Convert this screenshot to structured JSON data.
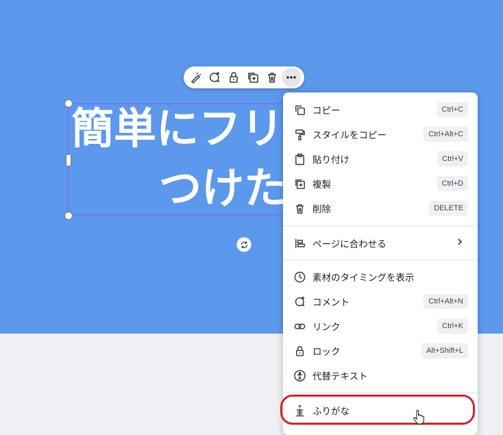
{
  "canvas": {
    "title_line1": "簡単にフリ",
    "title_line2": "つけた",
    "bg_color": "#5c98eb"
  },
  "minibar": {
    "icons": [
      "magic-edit-icon",
      "comment-add-icon",
      "lock-icon",
      "duplicate-icon",
      "trash-icon",
      "more-icon"
    ]
  },
  "menu": {
    "copy": {
      "label": "コピー",
      "shortcut": "Ctrl+C"
    },
    "copy_style": {
      "label": "スタイルをコピー",
      "shortcut": "Ctrl+Alt+C"
    },
    "paste": {
      "label": "貼り付け",
      "shortcut": "Ctrl+V"
    },
    "duplicate": {
      "label": "複製",
      "shortcut": "Ctrl+D"
    },
    "delete": {
      "label": "削除",
      "shortcut": "DELETE"
    },
    "align_to_page": {
      "label": "ページに合わせる"
    },
    "show_timing": {
      "label": "素材のタイミングを表示"
    },
    "comment": {
      "label": "コメント",
      "shortcut": "Ctrl+Alt+N"
    },
    "link": {
      "label": "リンク",
      "shortcut": "Ctrl+K"
    },
    "lock": {
      "label": "ロック",
      "shortcut": "Alt+Shift+L"
    },
    "alt_text": {
      "label": "代替テキスト"
    },
    "furigana": {
      "label": "ふりがな"
    }
  },
  "colors": {
    "highlight": "#d4202a",
    "selection": "#8b5cf6"
  }
}
